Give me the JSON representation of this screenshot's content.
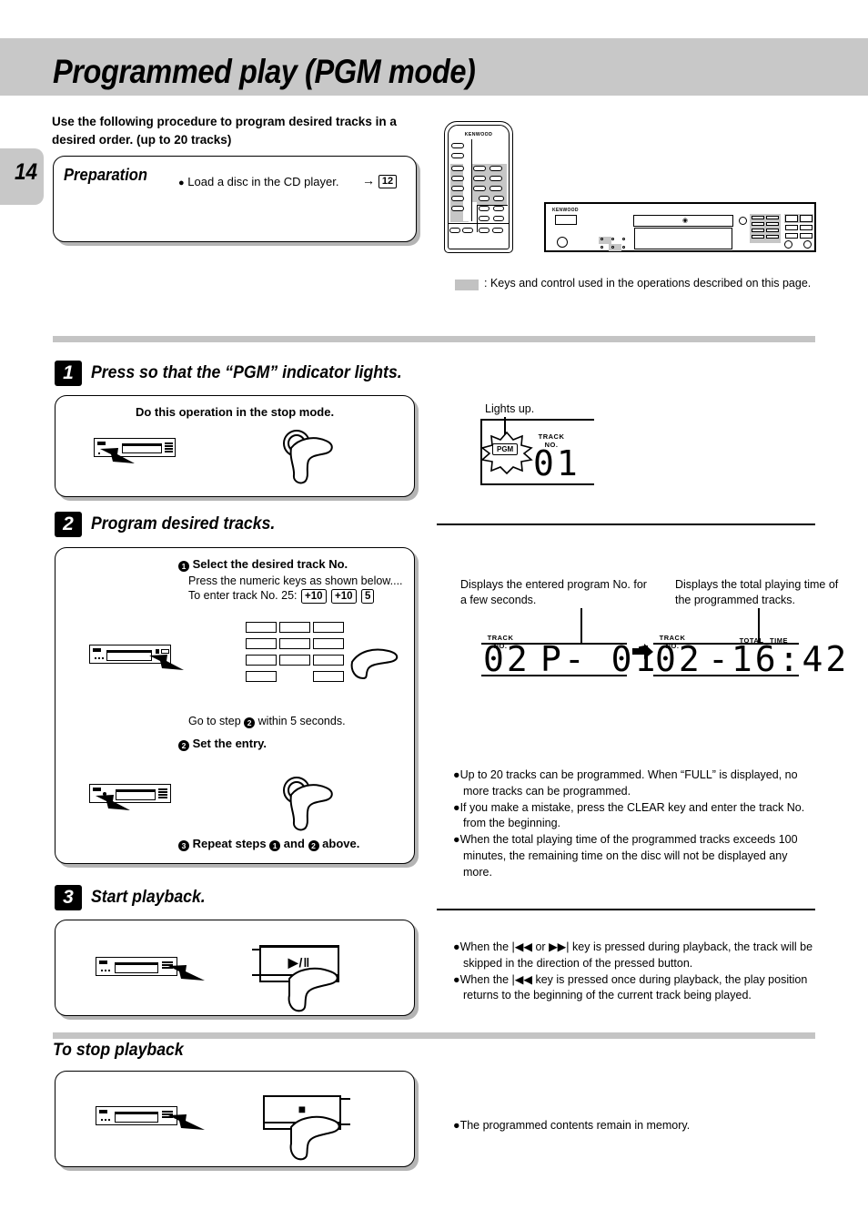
{
  "page": {
    "number": "14",
    "title": "Programmed play (PGM mode)",
    "intro": "Use the following procedure to program desired tracks in a desired order. (up to 20 tracks)"
  },
  "preparation": {
    "title": "Preparation",
    "bullet": "Load a disc in the CD player.",
    "arrow": "→",
    "page_ref": "12"
  },
  "devices": {
    "remote_brand": "KENWOOD",
    "deck_brand": "KENWOOD",
    "legend": ": Keys and control used in the operations described on this page.",
    "highlight_color": "#c6c6c6"
  },
  "step1": {
    "number": "1",
    "title": "Press so that the “PGM” indicator lights.",
    "box_note": "Do this operation in the stop mode.",
    "callout": "Lights up.",
    "display": {
      "pgm_label": "PGM",
      "track_label_1": "TRACK",
      "track_label_2": "NO.",
      "track_value": "01"
    }
  },
  "step2": {
    "number": "2",
    "title": "Program desired tracks.",
    "sub1_num": "1",
    "sub1_title": "Select the desired track No.",
    "sub1_line1": "Press the numeric keys as shown below....",
    "sub1_line2_prefix": "To enter track No. 25:",
    "keys": [
      "+10",
      "+10",
      "5"
    ],
    "goto_prefix": "Go to step",
    "goto_num": "2",
    "goto_suffix": "within 5 seconds.",
    "sub2_num": "2",
    "sub2_title": "Set the entry.",
    "sub3_num": "3",
    "sub3_prefix": "Repeat steps",
    "sub3_a": "1",
    "sub3_mid": "and",
    "sub3_b": "2",
    "sub3_suffix": "above.",
    "caption_left": "Displays the entered program No. for a few seconds.",
    "caption_right": "Displays the total playing time of the programmed tracks.",
    "display_left": {
      "track_label_1": "TRACK",
      "track_label_2": "NO.",
      "track_value": "02",
      "program_value": "P- 01"
    },
    "display_right": {
      "track_label_1": "TRACK",
      "track_label_2": "NO.",
      "track_value": "02",
      "total_label": "TOTAL",
      "time_label": "TIME",
      "time_value": "-16:42"
    },
    "notes": [
      "Up to 20 tracks can be programmed.  When “FULL” is displayed, no more tracks can be programmed.",
      "If you make a mistake, press the CLEAR key and enter  the track No. from the beginning.",
      "When the total playing time of the programmed tracks exceeds 100 minutes, the remaining time on the disc will not be displayed any more."
    ],
    "note_bold_1": "FULL",
    "note_bold_2": "CLEAR"
  },
  "step3": {
    "number": "3",
    "title": "Start playback.",
    "button_label": "▶/‖",
    "notes": [
      "When the |◀◀ or ▶▶| key is pressed during playback,  the track will be skipped in the direction of the  pressed button.",
      "When the |◀◀ key is pressed once during playback, the  play position returns to the beginning of the current  track being played."
    ]
  },
  "stop": {
    "title": "To stop playback",
    "button_label": "■",
    "note": "The programmed contents remain in memory."
  }
}
